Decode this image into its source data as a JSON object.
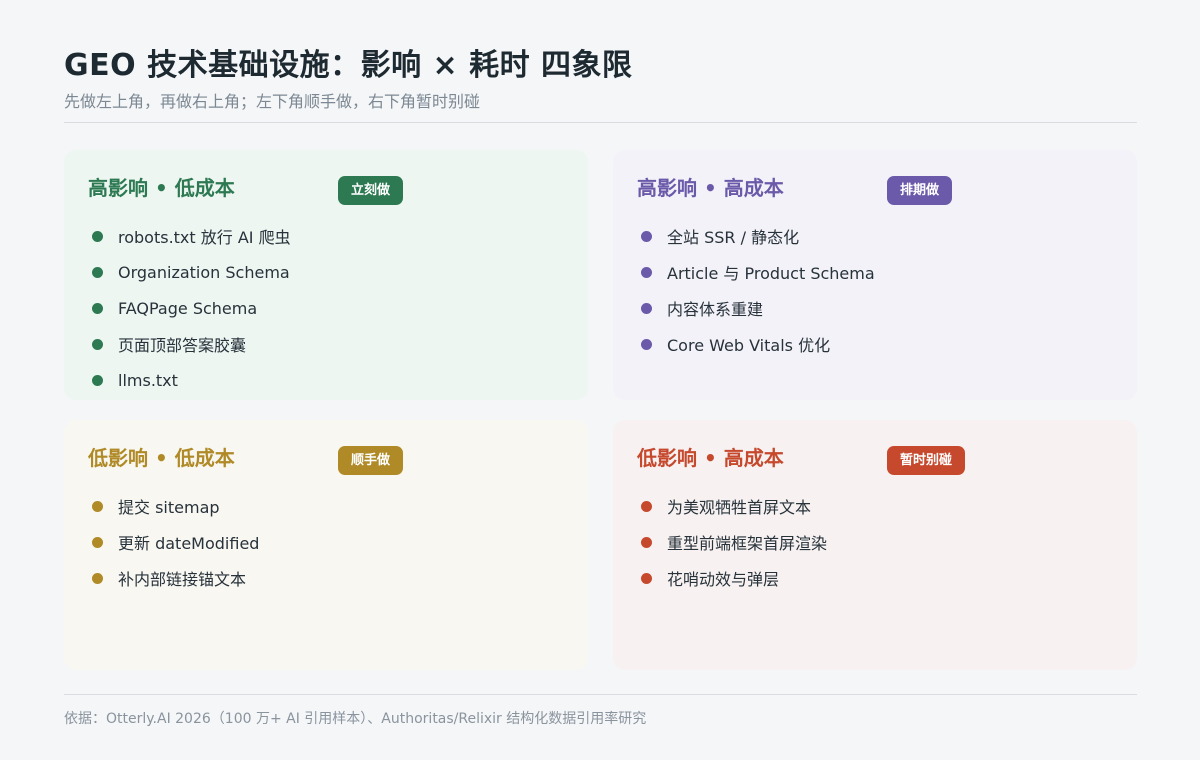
{
  "header": {
    "title": "GEO 技术基础设施：影响 × 耗时 四象限",
    "subtitle": "先做左上角，再做右上角；左下角顺手做，右下角暂时别碰"
  },
  "quadrants": [
    {
      "title": "高影响 • 低成本",
      "badge": "立刻做",
      "color": "#2d7a52",
      "items": [
        "robots.txt 放行 AI 爬虫",
        "Organization Schema",
        "FAQPage Schema",
        "页面顶部答案胶囊",
        "llms.txt"
      ]
    },
    {
      "title": "高影响 • 高成本",
      "badge": "排期做",
      "color": "#6b5aaa",
      "items": [
        "全站 SSR / 静态化",
        "Article 与 Product Schema",
        "内容体系重建",
        "Core Web Vitals 优化"
      ]
    },
    {
      "title": "低影响 • 低成本",
      "badge": "顺手做",
      "color": "#b08a26",
      "items": [
        "提交 sitemap",
        "更新 dateModified",
        "补内部链接锚文本"
      ]
    },
    {
      "title": "低影响 • 高成本",
      "badge": "暂时别碰",
      "color": "#c6492e",
      "items": [
        "为美观牺牲首屏文本",
        "重型前端框架首屏渲染",
        "花哨动效与弹层"
      ]
    }
  ],
  "footer": {
    "source": "依据：Otterly.AI 2026（100 万+ AI 引用样本）、Authoritas/Relixir 结构化数据引用率研究"
  }
}
